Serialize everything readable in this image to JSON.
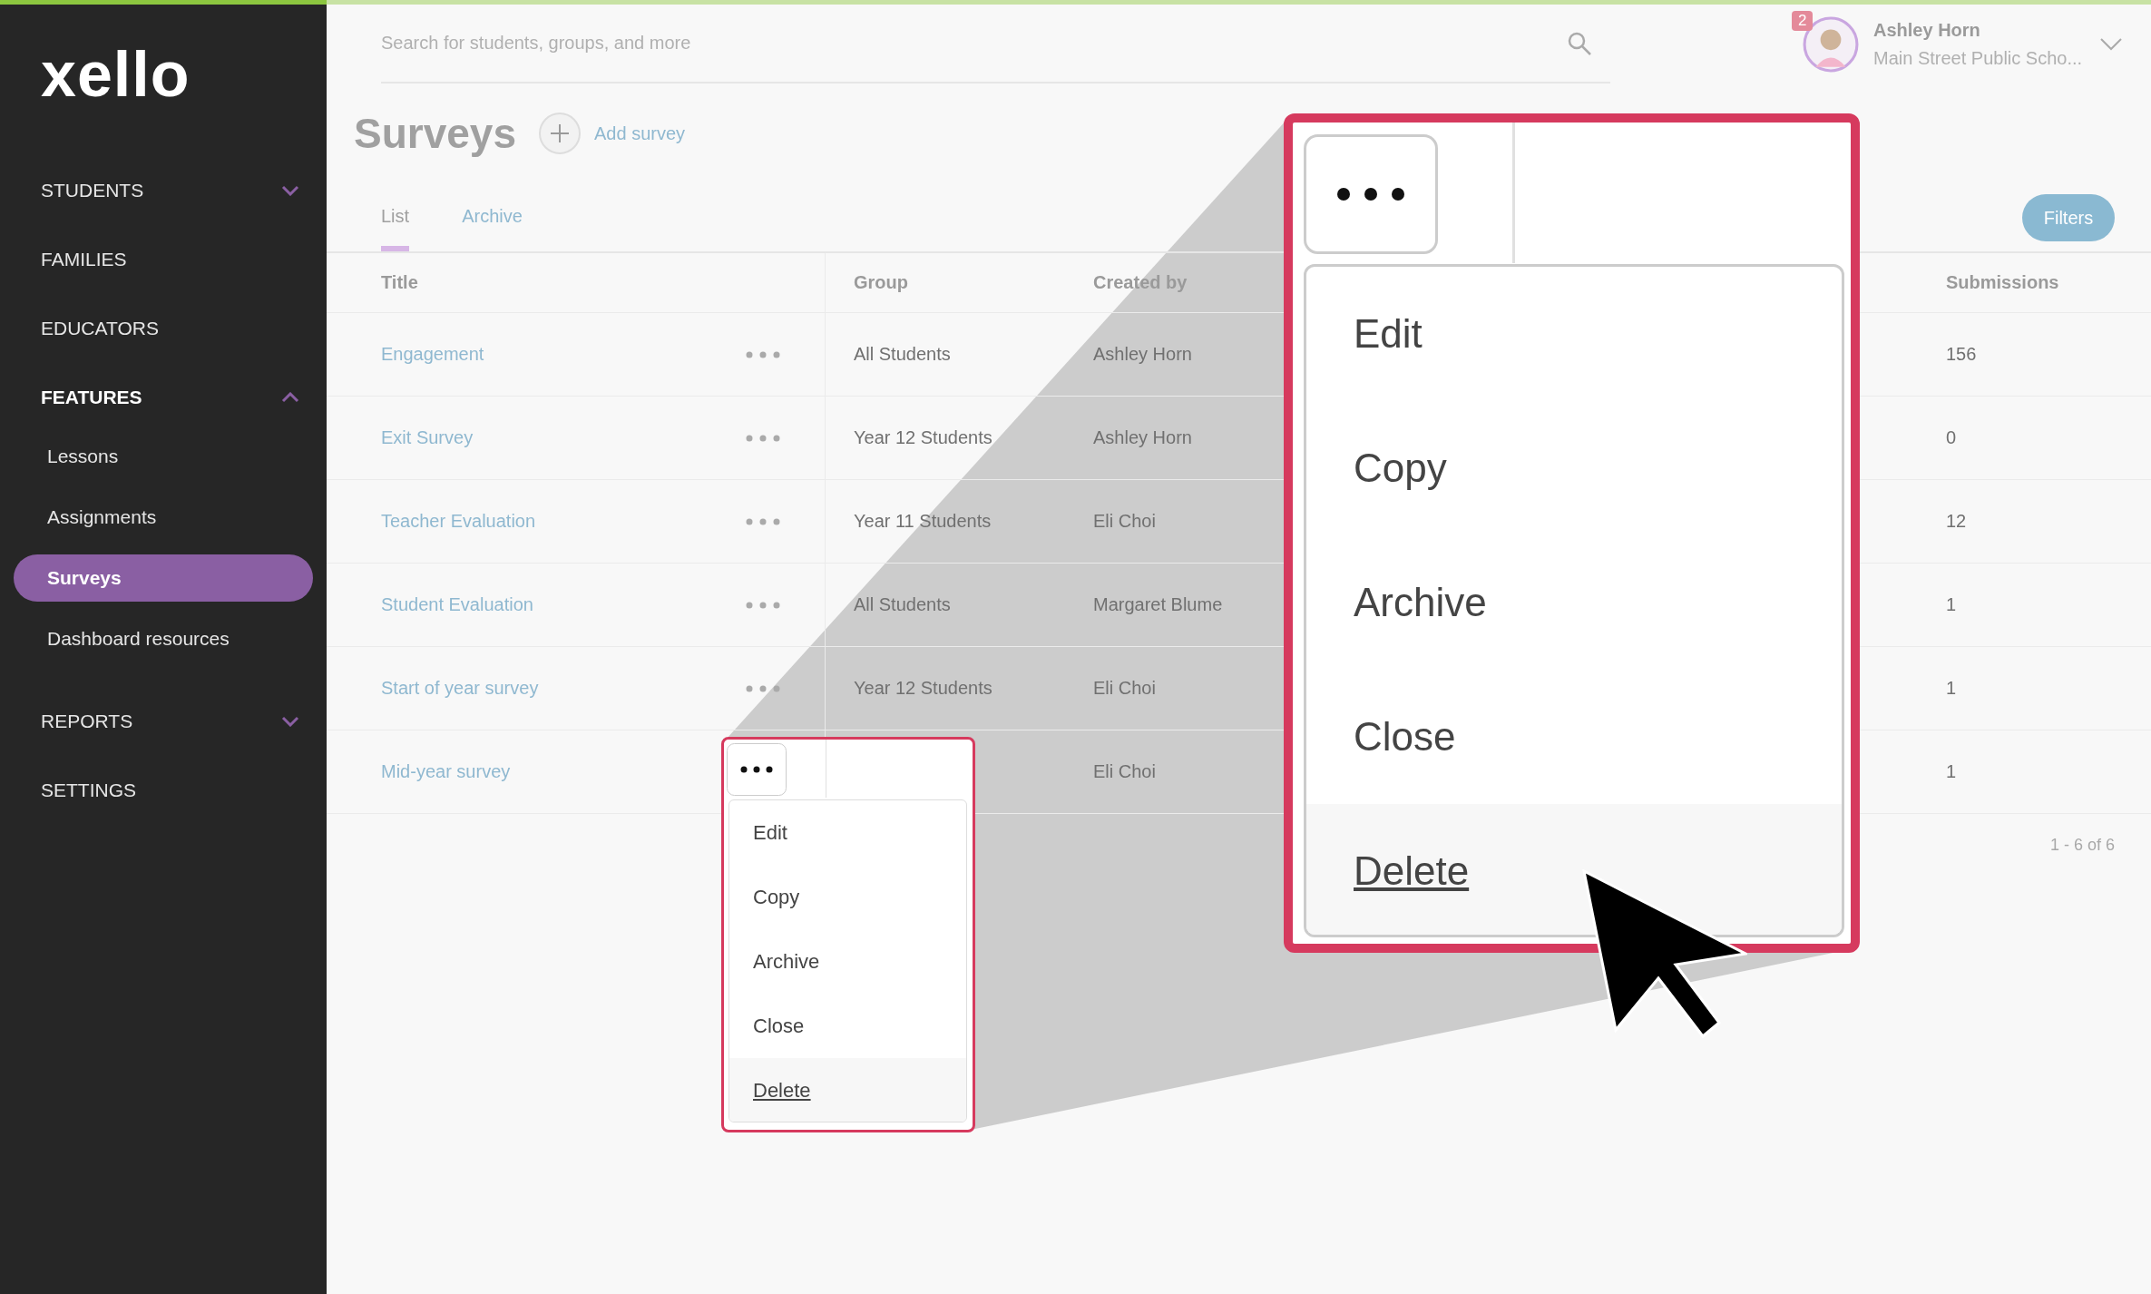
{
  "sidebar": {
    "logo": "xello",
    "items": [
      {
        "label": "STUDENTS",
        "kind": "group",
        "expanded": false
      },
      {
        "label": "FAMILIES",
        "kind": "link"
      },
      {
        "label": "EDUCATORS",
        "kind": "link"
      },
      {
        "label": "FEATURES",
        "kind": "group",
        "expanded": true,
        "children": [
          {
            "label": "Lessons",
            "selected": false
          },
          {
            "label": "Assignments",
            "selected": false
          },
          {
            "label": "Surveys",
            "selected": true
          },
          {
            "label": "Dashboard resources",
            "selected": false
          }
        ]
      },
      {
        "label": "REPORTS",
        "kind": "group",
        "expanded": false
      },
      {
        "label": "SETTINGS",
        "kind": "link"
      }
    ]
  },
  "header": {
    "search": {
      "placeholder": "Search for students, groups, and more"
    },
    "notifications": "2",
    "user": {
      "name": "Ashley Horn",
      "school": "Main Street Public Scho..."
    }
  },
  "page": {
    "title": "Surveys",
    "add_button": "Add survey",
    "tabs": [
      {
        "label": "List",
        "selected": true
      },
      {
        "label": "Archive",
        "selected": false
      }
    ],
    "filters_button": "Filters"
  },
  "table": {
    "columns": [
      "Title",
      "Group",
      "Created by",
      "Submissions"
    ],
    "rows": [
      {
        "title": "Engagement",
        "group": "All Students",
        "created_by": "Ashley Horn",
        "submissions": "156"
      },
      {
        "title": "Exit Survey",
        "group": "Year 12 Students",
        "created_by": "Ashley Horn",
        "submissions": "0"
      },
      {
        "title": "Teacher Evaluation",
        "group": "Year 11 Students",
        "created_by": "Eli Choi",
        "submissions": "12"
      },
      {
        "title": "Student Evaluation",
        "group": "All Students",
        "created_by": "Margaret Blume",
        "submissions": "1"
      },
      {
        "title": "Start of year survey",
        "group": "Year 12 Students",
        "created_by": "Eli Choi",
        "submissions": "1"
      },
      {
        "title": "Mid-year survey",
        "menu_open": true,
        "created_by": "Eli Choi",
        "submissions": "1"
      }
    ],
    "pagination": "1 - 6 of 6"
  },
  "actions_menu": {
    "items": [
      {
        "label": "Edit",
        "hovered": false
      },
      {
        "label": "Copy",
        "hovered": false
      },
      {
        "label": "Archive",
        "hovered": false
      },
      {
        "label": "Close",
        "hovered": false
      },
      {
        "label": "Delete",
        "hovered": true
      }
    ]
  },
  "zoom_callout": {
    "items": [
      {
        "label": "Edit",
        "hovered": false
      },
      {
        "label": "Copy",
        "hovered": false
      },
      {
        "label": "Archive",
        "hovered": false
      },
      {
        "label": "Close",
        "hovered": false
      },
      {
        "label": "Delete",
        "hovered": true
      }
    ]
  }
}
